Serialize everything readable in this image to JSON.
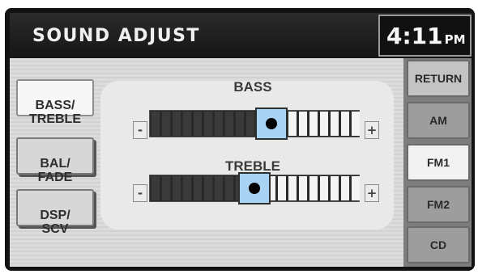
{
  "header": {
    "title": "SOUND ADJUST",
    "time": "4:11",
    "ampm": "PM"
  },
  "modes": [
    {
      "label": "BASS/\nTREBLE",
      "active": true
    },
    {
      "label": "BAL/\nFADE",
      "active": false
    },
    {
      "label": "DSP/\nSCV",
      "active": false
    }
  ],
  "sliders": [
    {
      "label": "BASS",
      "minus": "-",
      "plus": "+",
      "level": 0.58
    },
    {
      "label": "TREBLE",
      "minus": "-",
      "plus": "+",
      "level": 0.5
    }
  ],
  "sources": [
    {
      "label": "RETURN",
      "active": false
    },
    {
      "label": "AM",
      "active": false
    },
    {
      "label": "FM1",
      "active": true
    },
    {
      "label": "FM2",
      "active": false
    },
    {
      "label": "CD",
      "active": false
    }
  ],
  "colors": {
    "thumb": "#a9d3f2",
    "filled_segment": "#3a3a3a",
    "empty_segment": "#f4f4f4"
  }
}
